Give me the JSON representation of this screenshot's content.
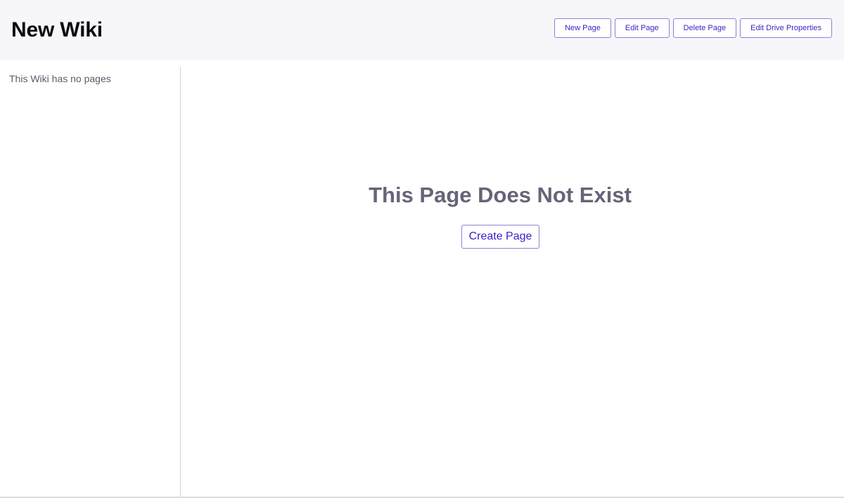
{
  "header": {
    "title": "New Wiki",
    "actions": {
      "new_page": "New Page",
      "edit_page": "Edit Page",
      "delete_page": "Delete Page",
      "edit_drive_properties": "Edit Drive Properties"
    }
  },
  "sidebar": {
    "empty_message": "This Wiki has no pages"
  },
  "main": {
    "missing_title": "This Page Does Not Exist",
    "create_label": "Create Page"
  },
  "colors": {
    "accent": "#3a24c9",
    "button_border": "#8a84d6",
    "header_bg": "#f7f7fb",
    "muted_text": "#666478"
  }
}
